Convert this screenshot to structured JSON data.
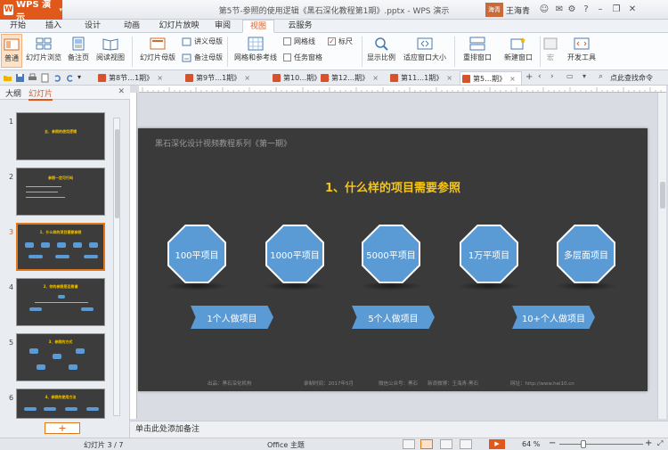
{
  "app": {
    "name": "WPS 演示",
    "window_title": "第5节-参照的使用逻辑《黑石深化教程第1期》.pptx - WPS 演示",
    "user_badge": "海青",
    "user_name": "王海青"
  },
  "menu_tabs": [
    {
      "label": "开始"
    },
    {
      "label": "插入"
    },
    {
      "label": "设计"
    },
    {
      "label": "动画"
    },
    {
      "label": "幻灯片放映"
    },
    {
      "label": "审阅"
    },
    {
      "label": "视图"
    },
    {
      "label": "云服务"
    }
  ],
  "active_menu_tab": "视图",
  "ribbon": {
    "normal": "普通",
    "slide_browse": "幻灯片浏览",
    "notes_page": "备注页",
    "reading_view": "阅读视图",
    "slide_master": "幻灯片母版",
    "handout_master": "讲义母版",
    "notes_master": "备注母版",
    "grid_guides": "网格和参考线",
    "gridlines": "网格线",
    "ruler": "标尺",
    "task_pane": "任务窗格",
    "zoom": "显示比例",
    "fit_window": "适应窗口大小",
    "arrange_window": "重排窗口",
    "new_window": "新建窗口",
    "macro": "宏",
    "dev_tools": "开发工具"
  },
  "doc_tabs": [
    {
      "label": "第8节…1期》"
    },
    {
      "label": "第9节…1期》"
    },
    {
      "label": "第10…期》"
    },
    {
      "label": "第12…期》"
    },
    {
      "label": "第11…1期》"
    },
    {
      "label": "第5…期》"
    }
  ],
  "search_command": "点此查找命令",
  "left_panel": {
    "tab_outline": "大纲",
    "tab_slides": "幻灯片",
    "thumbnails": [
      {
        "num": "1",
        "title": "五、参照的使用逻辑"
      },
      {
        "num": "2",
        "title": "参照一定可行吗"
      },
      {
        "num": "3",
        "title": "1、什么样的项目需要参照"
      },
      {
        "num": "4",
        "title": "2、你的参照是否靠谱"
      },
      {
        "num": "5",
        "title": "3、参照的方式"
      },
      {
        "num": "6",
        "title": "4、参照的使用方法"
      }
    ],
    "add_slide": "+"
  },
  "slide": {
    "series": "黑石深化设计视频教程系列《第一期》",
    "title": "1、什么样的项目需要参照",
    "octagons": [
      {
        "label": "100平项目"
      },
      {
        "label": "1000平项目"
      },
      {
        "label": "5000平项目"
      },
      {
        "label": "1万平项目"
      },
      {
        "label": "多层面项目"
      }
    ],
    "banners": [
      {
        "label": "1个人做项目"
      },
      {
        "label": "5个人做项目"
      },
      {
        "label": "10+个人做项目"
      }
    ],
    "footer": [
      {
        "text": "出品：黑石深化机构"
      },
      {
        "text": "录制时间：2017年5月"
      },
      {
        "text": "微信公众号：黑石"
      },
      {
        "text": "新浪微博：王海青-黑石"
      },
      {
        "text": "网址：http://www.hei10.cn"
      }
    ]
  },
  "notes_placeholder": "单击此处添加备注",
  "status": {
    "slide_counter": "幻灯片 3 / 7",
    "theme": "Office 主题",
    "zoom": "64 %",
    "zoom_value": 64
  },
  "colors": {
    "accent": "#e0591b",
    "slide_bg": "#3a3a3a",
    "shape_blue": "#5b9bd5",
    "title_yellow": "#f5c518"
  }
}
